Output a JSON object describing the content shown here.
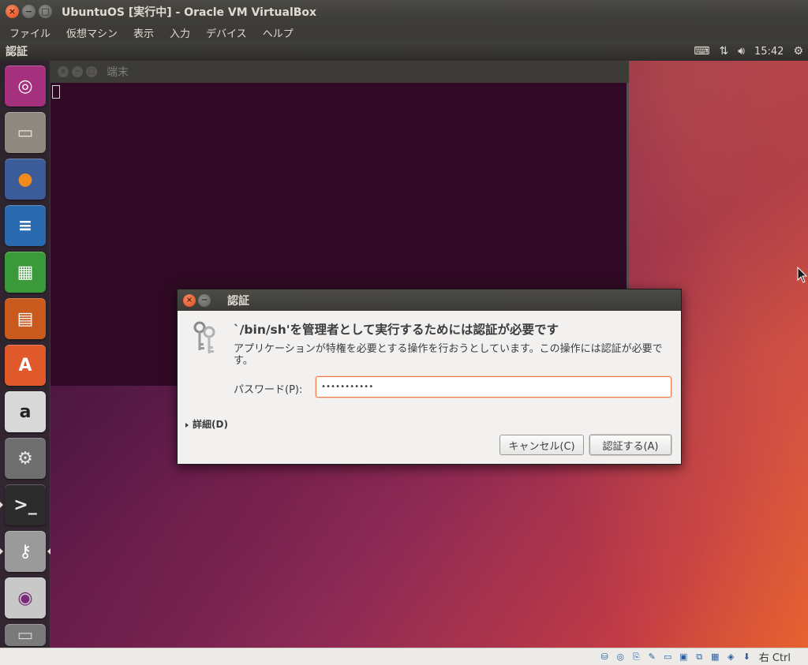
{
  "window": {
    "title": "UbuntuOS [実行中] - Oracle VM VirtualBox",
    "close_glyph": "×",
    "min_glyph": "−",
    "max_glyph": "□"
  },
  "menubar": [
    "ファイル",
    "仮想マシン",
    "表示",
    "入力",
    "デバイス",
    "ヘルプ"
  ],
  "top_panel": {
    "app_name": "認証",
    "time": "15:42",
    "icons": [
      "keyboard-icon",
      "network-icon",
      "volume-icon",
      "settings-gear-icon"
    ]
  },
  "launcher": {
    "items": [
      {
        "name": "ubuntu-dash",
        "glyph": "◎",
        "bg": "#a5307e",
        "fg": "#ffffff"
      },
      {
        "name": "files",
        "glyph": "▭",
        "bg": "#8f8a80",
        "fg": "#e8e4dc"
      },
      {
        "name": "firefox",
        "glyph": "●",
        "bg": "#3b5c99",
        "fg": "#f28a1c"
      },
      {
        "name": "libreoffice-writer",
        "glyph": "≡",
        "bg": "#2a6bb0",
        "fg": "#ffffff"
      },
      {
        "name": "libreoffice-calc",
        "glyph": "▦",
        "bg": "#3a9a3a",
        "fg": "#ffffff"
      },
      {
        "name": "libreoffice-impress",
        "glyph": "▤",
        "bg": "#c85a1e",
        "fg": "#ffffff"
      },
      {
        "name": "ubuntu-software",
        "glyph": "A",
        "bg": "#e0592a",
        "fg": "#ffffff"
      },
      {
        "name": "amazon",
        "glyph": "a",
        "bg": "#d8d8d8",
        "fg": "#222222"
      },
      {
        "name": "system-settings",
        "glyph": "⚙",
        "bg": "#6f6f6f",
        "fg": "#e8e8e8"
      },
      {
        "name": "terminal",
        "glyph": ">_",
        "bg": "#2c2c2c",
        "fg": "#e8e8e8"
      },
      {
        "name": "authentication-keys",
        "glyph": "⚷",
        "bg": "#9a9a9a",
        "fg": "#ffffff"
      },
      {
        "name": "dvd-drive",
        "glyph": "◉",
        "bg": "#c8c8c8",
        "fg": "#7a2a7a"
      },
      {
        "name": "trash",
        "glyph": "▭",
        "bg": "#7a7a7a",
        "fg": "#d0d0d0"
      }
    ]
  },
  "terminal": {
    "title": "端末"
  },
  "dialog": {
    "title": "認証",
    "heading": "`/bin/sh'を管理者として実行するためには認証が必要です",
    "message": "アプリケーションが特権を必要とする操作を行おうとしています。この操作には認証が必要です。",
    "password_label": "パスワード(P):",
    "password_value": "•••••••••••",
    "details_label": "詳細(D)",
    "cancel_label": "キャンセル(C)",
    "auth_label": "認証する(A)"
  },
  "statusbar": {
    "icons": [
      "hard-disk-icon",
      "optical-disk-icon",
      "usb-icon",
      "shared-folder-icon",
      "display-icon",
      "network-adapter-icon",
      "video-capture-icon",
      "cpu-icon",
      "mouse-integration-icon",
      "keyboard-capture-icon"
    ],
    "glyphs": [
      "⛁",
      "◎",
      "⎘",
      "✎",
      "▭",
      "▣",
      "⧉",
      "▦",
      "◈",
      "⬇"
    ],
    "host_key": "右 Ctrl"
  },
  "colors": {
    "accent": "#f07746",
    "ubuntu_orange": "#e95420",
    "terminal_bg": "#300a24"
  }
}
